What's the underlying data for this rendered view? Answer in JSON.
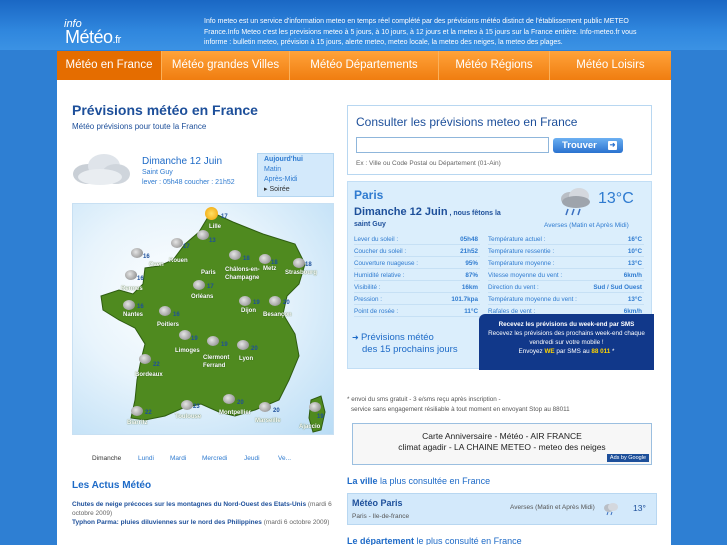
{
  "header": {
    "logo_info": "info",
    "logo_meteo": "Météo",
    "logo_fr": ".fr",
    "description": "Info meteo est un service d'information meteo en temps réel complété par des prévisions météo distinct de l'établissement public METEO France.Info Meteo c'est les previsions meteo à 5 jours, à 10 jours, à 12 jours et la meteo à 15 jours sur la France entière. Info-meteo.fr vous informe : bulletin meteo, prévision à 15 jours, alerte meteo, meteo locale, la meteo des neiges, la meteo des plages."
  },
  "nav": [
    {
      "label": "Météo en France",
      "active": true
    },
    {
      "label": "Météo grandes Villes"
    },
    {
      "label": "Météo Départements"
    },
    {
      "label": "Météo Régions"
    },
    {
      "label": "Météo Loisirs"
    }
  ],
  "left": {
    "title": "Prévisions météo en France",
    "subtitle": "Météo prévisions pour toute la France",
    "today": {
      "date": "Dimanche 12 Juin",
      "saint": "Saint Guy",
      "sun": "lever : 05h48 coucher : 21h52",
      "icon": "cloud-icon"
    },
    "periods": [
      "Aujourd'hui",
      "Matin",
      "Après-Midi",
      "Soirée"
    ],
    "map": {
      "cities": [
        {
          "name": "Lille",
          "temp": "17",
          "icon": "sun-icon"
        },
        {
          "name": "Caen",
          "temp": "16",
          "icon": "cloud-icon"
        },
        {
          "name": "Rouen",
          "temp": "17",
          "icon": "cloud-icon"
        },
        {
          "name": "Paris",
          "temp": "13",
          "icon": "rain-icon"
        },
        {
          "name": "Châlons-en-Champagne",
          "temp": "18",
          "icon": "rain-icon"
        },
        {
          "name": "Metz",
          "temp": "18",
          "icon": "rain-icon"
        },
        {
          "name": "Strasbourg",
          "temp": "18",
          "icon": "rain-icon"
        },
        {
          "name": "Rennes",
          "temp": "16",
          "icon": "cloud-icon"
        },
        {
          "name": "Orléans",
          "temp": "17",
          "icon": "cloud-icon"
        },
        {
          "name": "Nantes",
          "temp": "16",
          "icon": "rain-icon"
        },
        {
          "name": "Dijon",
          "temp": "19",
          "icon": "rain-icon"
        },
        {
          "name": "Besançon",
          "temp": "20",
          "icon": "rain-icon"
        },
        {
          "name": "Poitiers",
          "temp": "16",
          "icon": "rain-icon"
        },
        {
          "name": "Limoges",
          "temp": "19",
          "icon": "rain-icon"
        },
        {
          "name": "Clermont Ferrand",
          "temp": "19",
          "icon": "cloud-icon"
        },
        {
          "name": "Lyon",
          "temp": "20",
          "icon": "rain-icon"
        },
        {
          "name": "Bordeaux",
          "temp": "22",
          "icon": "rain-icon"
        },
        {
          "name": "Biarritz",
          "temp": "22",
          "icon": "rain-icon"
        },
        {
          "name": "Toulouse",
          "temp": "23",
          "icon": "rain-icon"
        },
        {
          "name": "Montpellier",
          "temp": "20",
          "icon": "rain-icon"
        },
        {
          "name": "Marseille",
          "temp": "20",
          "icon": "rain-icon"
        },
        {
          "name": "Ajaccio",
          "temp": "19",
          "icon": "rain-icon"
        }
      ]
    },
    "days": [
      "Dimanche",
      "Lundi",
      "Mardi",
      "Mercredi",
      "Jeudi",
      "Ve..."
    ],
    "actus_title": "Les Actus Météo",
    "actus": [
      {
        "headline": "Chutes de neige précoces sur les montagnes du Nord-Ouest des Etats-Unis",
        "date": "(mardi 6 octobre 2009)"
      },
      {
        "headline": "Typhon Parma: pluies diluviennes sur le nord des Philippines",
        "date": "(mardi 6 octobre 2009)"
      }
    ]
  },
  "right": {
    "search": {
      "title": "Consulter les prévisions meteo en France",
      "placeholder": "",
      "button": "Trouver",
      "hint": "Ex : Ville ou Code Postal ou Département (01-Ain)"
    },
    "paris": {
      "city": "Paris",
      "date": "Dimanche 12 Juin",
      "fete": " , nous fêtons la",
      "saint": "saint Guy",
      "temp": "13°C",
      "condition": "Averses (Matin et Après Midi)",
      "icon": "rain-icon",
      "stats_left": [
        {
          "label": "Lever du soleil :",
          "value": "05h48"
        },
        {
          "label": "Coucher du soleil :",
          "value": "21h52"
        },
        {
          "label": "Couverture nuageuse :",
          "value": "95%"
        },
        {
          "label": "Humidité relative :",
          "value": "87%"
        },
        {
          "label": "Visibilité :",
          "value": "16km"
        },
        {
          "label": "Pression :",
          "value": "101.7kpa"
        },
        {
          "label": "Point de rosée :",
          "value": "11°C"
        }
      ],
      "stats_right": [
        {
          "label": "Température actuel :",
          "value": "16°C"
        },
        {
          "label": "Température ressentie :",
          "value": "10°C"
        },
        {
          "label": "Température moyenne :",
          "value": "13°C"
        },
        {
          "label": "Vitesse moyenne du vent :",
          "value": "6km/h"
        },
        {
          "label": "Direction du vent :",
          "value": "Sud / Sud Ouest"
        },
        {
          "label": "Température moyenne du vent :",
          "value": "13°C"
        },
        {
          "label": "Rafales de vent :",
          "value": "6km/h"
        }
      ],
      "prev15_line1": "Prévisions météo",
      "prev15_line2": "des 15 prochains jours",
      "sms_line1": "Recevez les prévisions du week-end par SMS",
      "sms_line2": "Recevez les prévisions des prochains week-end chaque vendredi sur votre mobile !",
      "sms_line3a": "Envoyez ",
      "sms_we": "WE",
      "sms_line3b": " par SMS au ",
      "sms_number": "88 011",
      "sms_line3c": " *"
    },
    "sms_note1": "* envoi du sms gratuit - 3 e/sms reçu après inscription -",
    "sms_note2": "service sans engagement résiliable à tout moment en envoyant Stop au 88011",
    "ad_line1": "Carte Anniversaire - Météo - AIR FRANCE",
    "ad_line2": "climat agadir - LA CHAINE METEO - meteo des neiges",
    "ad_tag": "Ads by Google",
    "ville_title_a": "La ville",
    "ville_title_b": " la plus consultée en France",
    "ville": {
      "name": "Météo Paris",
      "region": "Paris - Ile-de-france",
      "condition": "Averses (Matin et Après Midi)",
      "temp": "13°",
      "icon": "rain-icon"
    },
    "dept_title_a": "Le département",
    "dept_title_b": " le plus consulté en France"
  },
  "colors": {
    "header_blue": "#2e7fd3",
    "nav_orange": "#f07d10",
    "title_blue": "#1d4f9a",
    "link_blue": "#2f7bd0",
    "sms_navy": "#11388a",
    "highlight_yellow": "#ffd400"
  }
}
